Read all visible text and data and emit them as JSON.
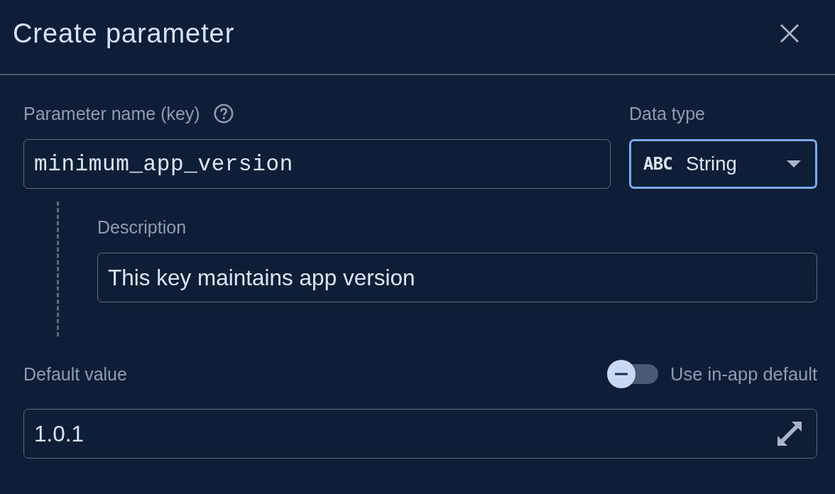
{
  "dialog": {
    "title": "Create parameter"
  },
  "parameter_name": {
    "label": "Parameter name (key)",
    "value": "minimum_app_version"
  },
  "data_type": {
    "label": "Data type",
    "type_icon_text": "ABC",
    "value": "String",
    "focused": true
  },
  "description": {
    "label": "Description",
    "value": "This key maintains app version"
  },
  "default_value": {
    "label": "Default value",
    "value": "1.0.1",
    "use_in_app_default": {
      "label": "Use in-app default",
      "on": false
    }
  }
}
